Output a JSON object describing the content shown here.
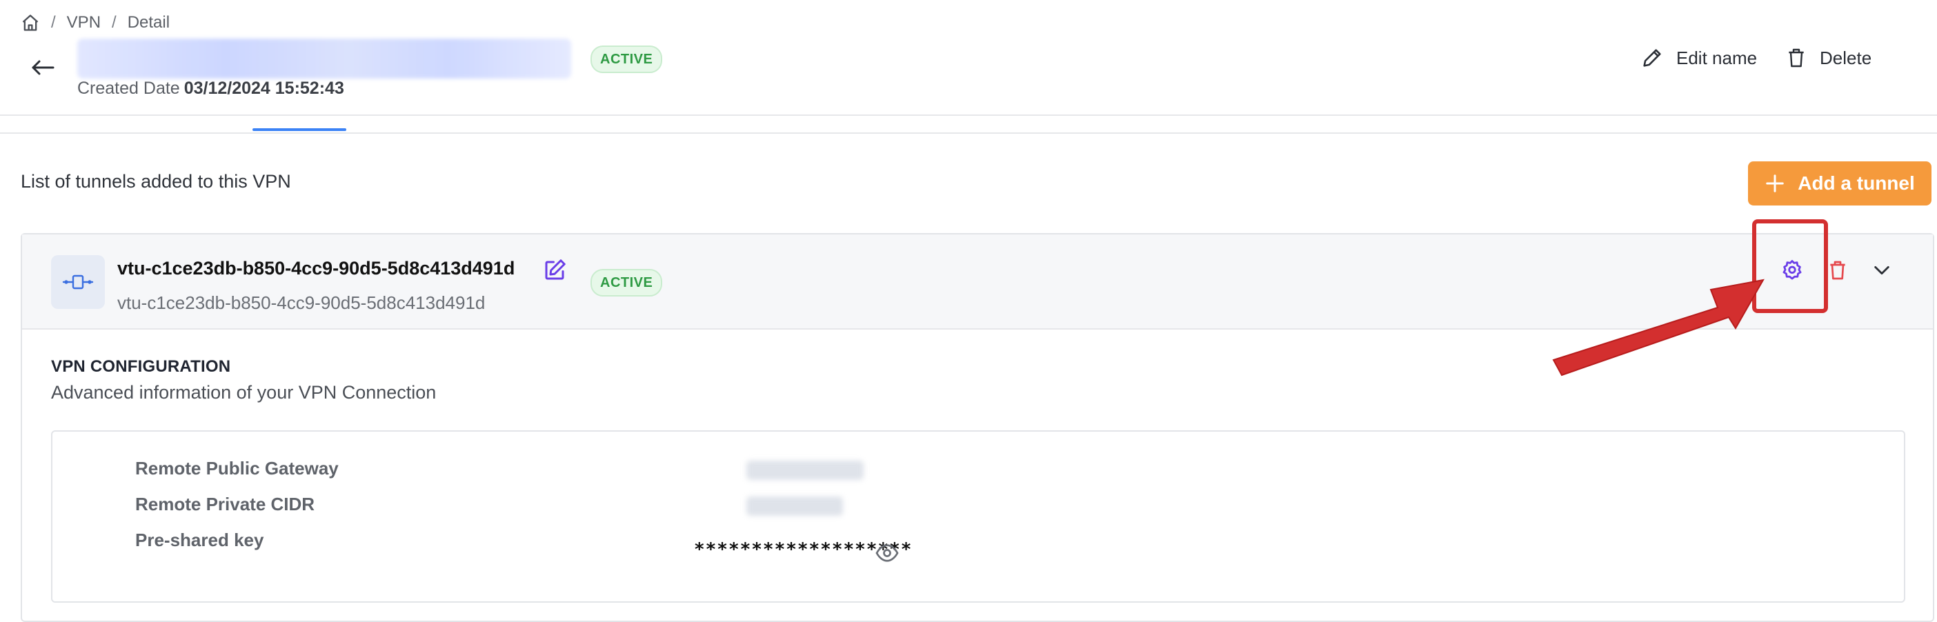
{
  "breadcrumb": {
    "items": [
      "VPN",
      "Detail"
    ],
    "separator": "/"
  },
  "header": {
    "status": "ACTIVE",
    "created_label": "Created Date",
    "created_value": "03/12/2024 15:52:43",
    "edit_name_label": "Edit name",
    "delete_label": "Delete"
  },
  "tunnels": {
    "list_title": "List of tunnels added to this VPN",
    "add_button": "Add a tunnel",
    "item": {
      "name": "vtu-c1ce23db-b850-4cc9-90d5-5d8c413d491d",
      "subtitle": "vtu-c1ce23db-b850-4cc9-90d5-5d8c413d491d",
      "status": "ACTIVE"
    }
  },
  "vpn_config": {
    "title": "VPN CONFIGURATION",
    "subtitle": "Advanced information of your VPN Connection",
    "rows": [
      {
        "label": "Remote Public Gateway"
      },
      {
        "label": "Remote Private CIDR"
      },
      {
        "label": "Pre-shared key",
        "value": "*******************"
      }
    ]
  },
  "colors": {
    "accent_orange": "#f59a3c",
    "active_green": "#2e9a43",
    "settings_purple": "#6a3ee8",
    "delete_red": "#e5484d",
    "annotation_red": "#d32f2f"
  },
  "icons": [
    "home-icon",
    "back-arrow-icon",
    "pencil-icon",
    "trash-icon",
    "plus-icon",
    "tunnel-icon",
    "edit-square-icon",
    "settings-icon",
    "chevron-down-icon",
    "eye-icon"
  ]
}
